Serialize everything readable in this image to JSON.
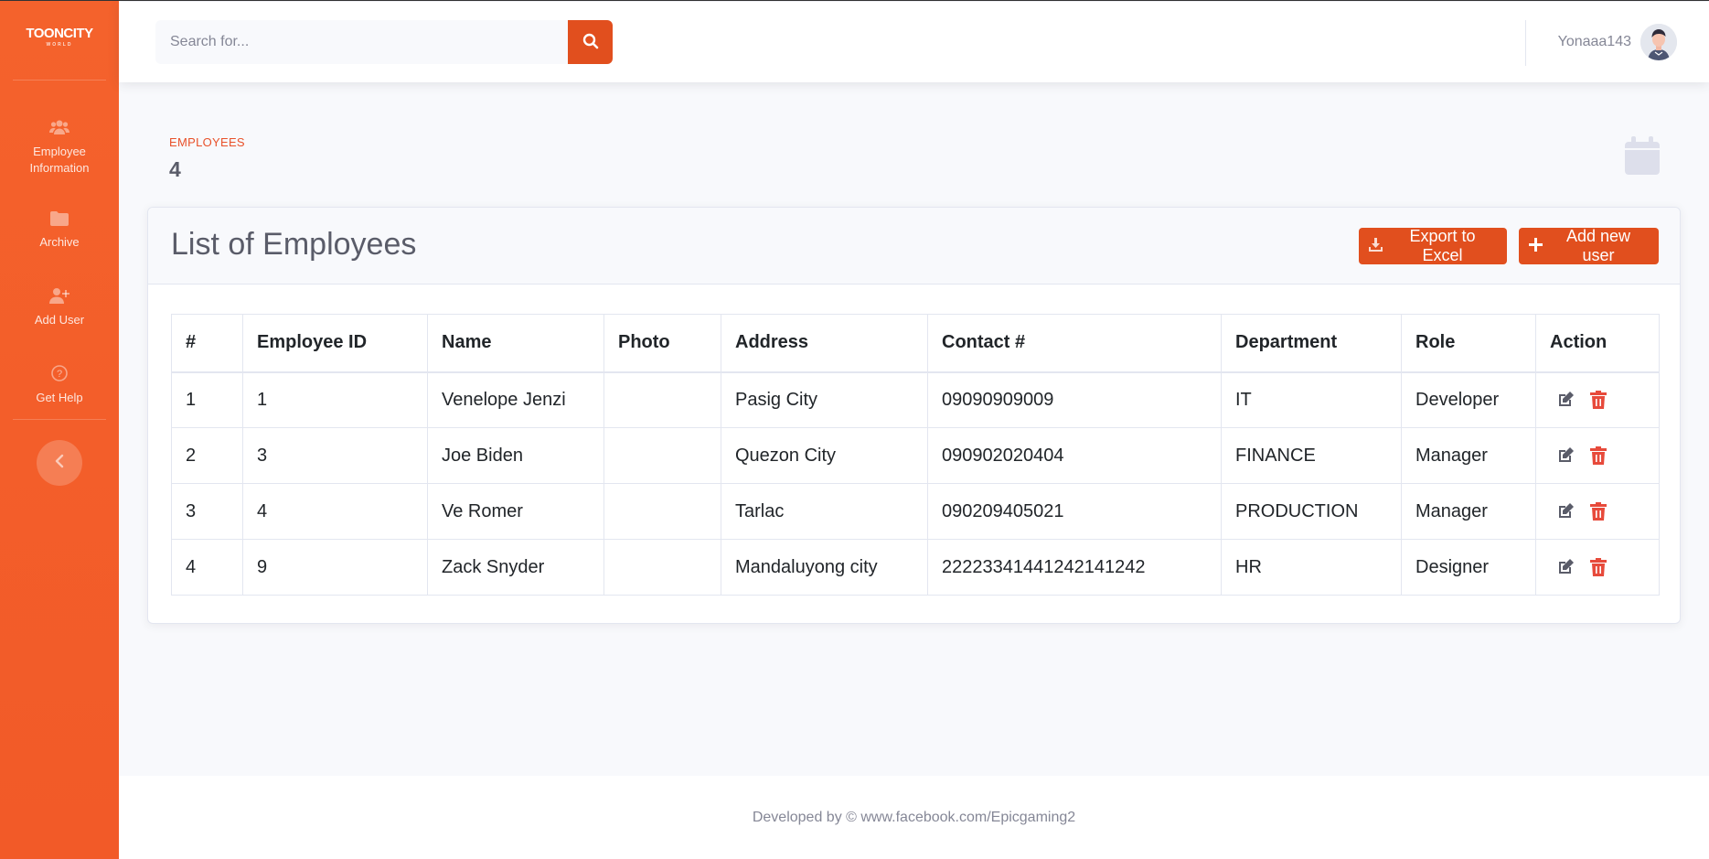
{
  "brand": {
    "name": "TOONCITY",
    "sub": "WORLD"
  },
  "sidebar": {
    "items": [
      {
        "label": "Employee Information",
        "icon": "users-icon"
      },
      {
        "label": "Archive",
        "icon": "folder-icon"
      },
      {
        "label": "Add User",
        "icon": "user-plus-icon"
      },
      {
        "label": "Get Help",
        "icon": "question-circle-icon"
      }
    ],
    "toggle_icon": "chevron-left-icon"
  },
  "topbar": {
    "search_placeholder": "Search for...",
    "username": "Yonaaa143"
  },
  "stats": {
    "label": "EMPLOYEES",
    "value": "4"
  },
  "card": {
    "title": "List of Employees",
    "export_label": "Export to Excel",
    "add_label": "Add new user"
  },
  "table": {
    "headers": [
      "#",
      "Employee ID",
      "Name",
      "Photo",
      "Address",
      "Contact #",
      "Department",
      "Role",
      "Action"
    ],
    "rows": [
      {
        "num": "1",
        "id": "1",
        "name": "Venelope Jenzi",
        "photo": "",
        "address": "Pasig City",
        "contact": "09090909009",
        "department": "IT",
        "role": "Developer"
      },
      {
        "num": "2",
        "id": "3",
        "name": "Joe Biden",
        "photo": "",
        "address": "Quezon City",
        "contact": "090902020404",
        "department": "FINANCE",
        "role": "Manager"
      },
      {
        "num": "3",
        "id": "4",
        "name": "Ve Romer",
        "photo": "",
        "address": "Tarlac",
        "contact": "090209405021",
        "department": "PRODUCTION",
        "role": "Manager"
      },
      {
        "num": "4",
        "id": "9",
        "name": "Zack Snyder",
        "photo": "",
        "address": "Mandaluyong city",
        "contact": "22223341441242141242",
        "department": "HR",
        "role": "Designer"
      }
    ]
  },
  "footer": {
    "text": "Developed by © www.facebook.com/Epicgaming2"
  },
  "colors": {
    "sidebar": "#f4622c",
    "accent": "#e14f1e",
    "delete": "#e74a3b",
    "edit": "#5a5c69"
  }
}
